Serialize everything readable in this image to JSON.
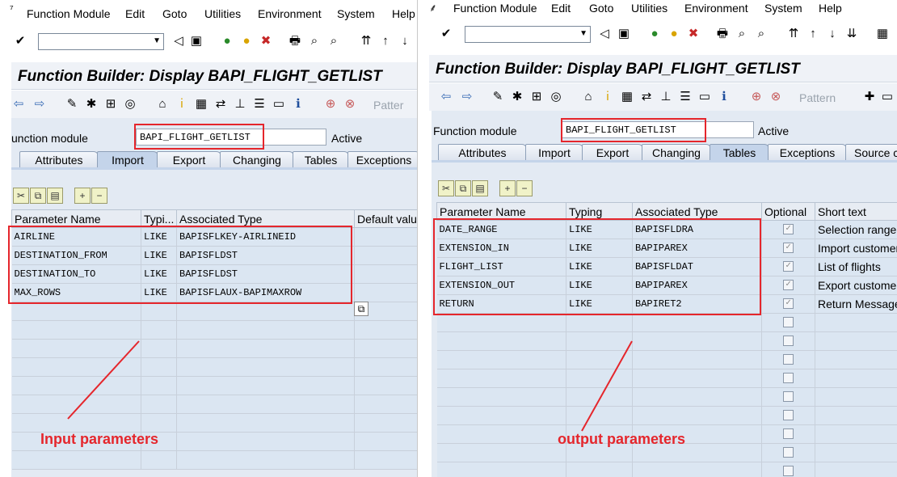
{
  "menu": [
    "Function Module",
    "Edit",
    "Goto",
    "Utilities",
    "Environment",
    "System",
    "Help"
  ],
  "left": {
    "title": "Function Builder: Display BAPI_FLIGHT_GETLIST",
    "pattern_label": "Patter",
    "fm_label": "unction module",
    "fm_value": "BAPI_FLIGHT_GETLIST",
    "status": "Active",
    "tabs": [
      "Attributes",
      "Import",
      "Export",
      "Changing",
      "Tables",
      "Exceptions"
    ],
    "active_tab": "Import",
    "columns": [
      "Parameter Name",
      "Typi...",
      "Associated Type",
      "Default value"
    ],
    "rows": [
      {
        "name": "AIRLINE",
        "typing": "LIKE",
        "type": "BAPISFLKEY-AIRLINEID"
      },
      {
        "name": "DESTINATION_FROM",
        "typing": "LIKE",
        "type": "BAPISFLDST"
      },
      {
        "name": "DESTINATION_TO",
        "typing": "LIKE",
        "type": "BAPISFLDST"
      },
      {
        "name": "MAX_ROWS",
        "typing": "LIKE",
        "type": "BAPISFLAUX-BAPIMAXROW"
      }
    ],
    "annotation": "Input parameters"
  },
  "right": {
    "title": "Function Builder: Display BAPI_FLIGHT_GETLIST",
    "pattern_label": "Pattern",
    "fm_label": "Function module",
    "fm_value": "BAPI_FLIGHT_GETLIST",
    "status": "Active",
    "tabs": [
      "Attributes",
      "Import",
      "Export",
      "Changing",
      "Tables",
      "Exceptions",
      "Source c"
    ],
    "active_tab": "Tables",
    "columns": [
      "Parameter Name",
      "Typing",
      "Associated Type",
      "Optional",
      "Short text"
    ],
    "rows": [
      {
        "name": "DATE_RANGE",
        "typing": "LIKE",
        "type": "BAPISFLDRA",
        "optional": true,
        "text": "Selection range f"
      },
      {
        "name": "EXTENSION_IN",
        "typing": "LIKE",
        "type": "BAPIPAREX",
        "optional": true,
        "text": "Import customer"
      },
      {
        "name": "FLIGHT_LIST",
        "typing": "LIKE",
        "type": "BAPISFLDAT",
        "optional": true,
        "text": "List of flights"
      },
      {
        "name": "EXTENSION_OUT",
        "typing": "LIKE",
        "type": "BAPIPAREX",
        "optional": true,
        "text": "Export customer"
      },
      {
        "name": "RETURN",
        "typing": "LIKE",
        "type": "BAPIRET2",
        "optional": true,
        "text": "Return Messages"
      }
    ],
    "annotation": "output parameters"
  },
  "colors": {
    "highlight": "#e5262c",
    "grid": "#dbe6f2",
    "header": "#eff2f7"
  }
}
